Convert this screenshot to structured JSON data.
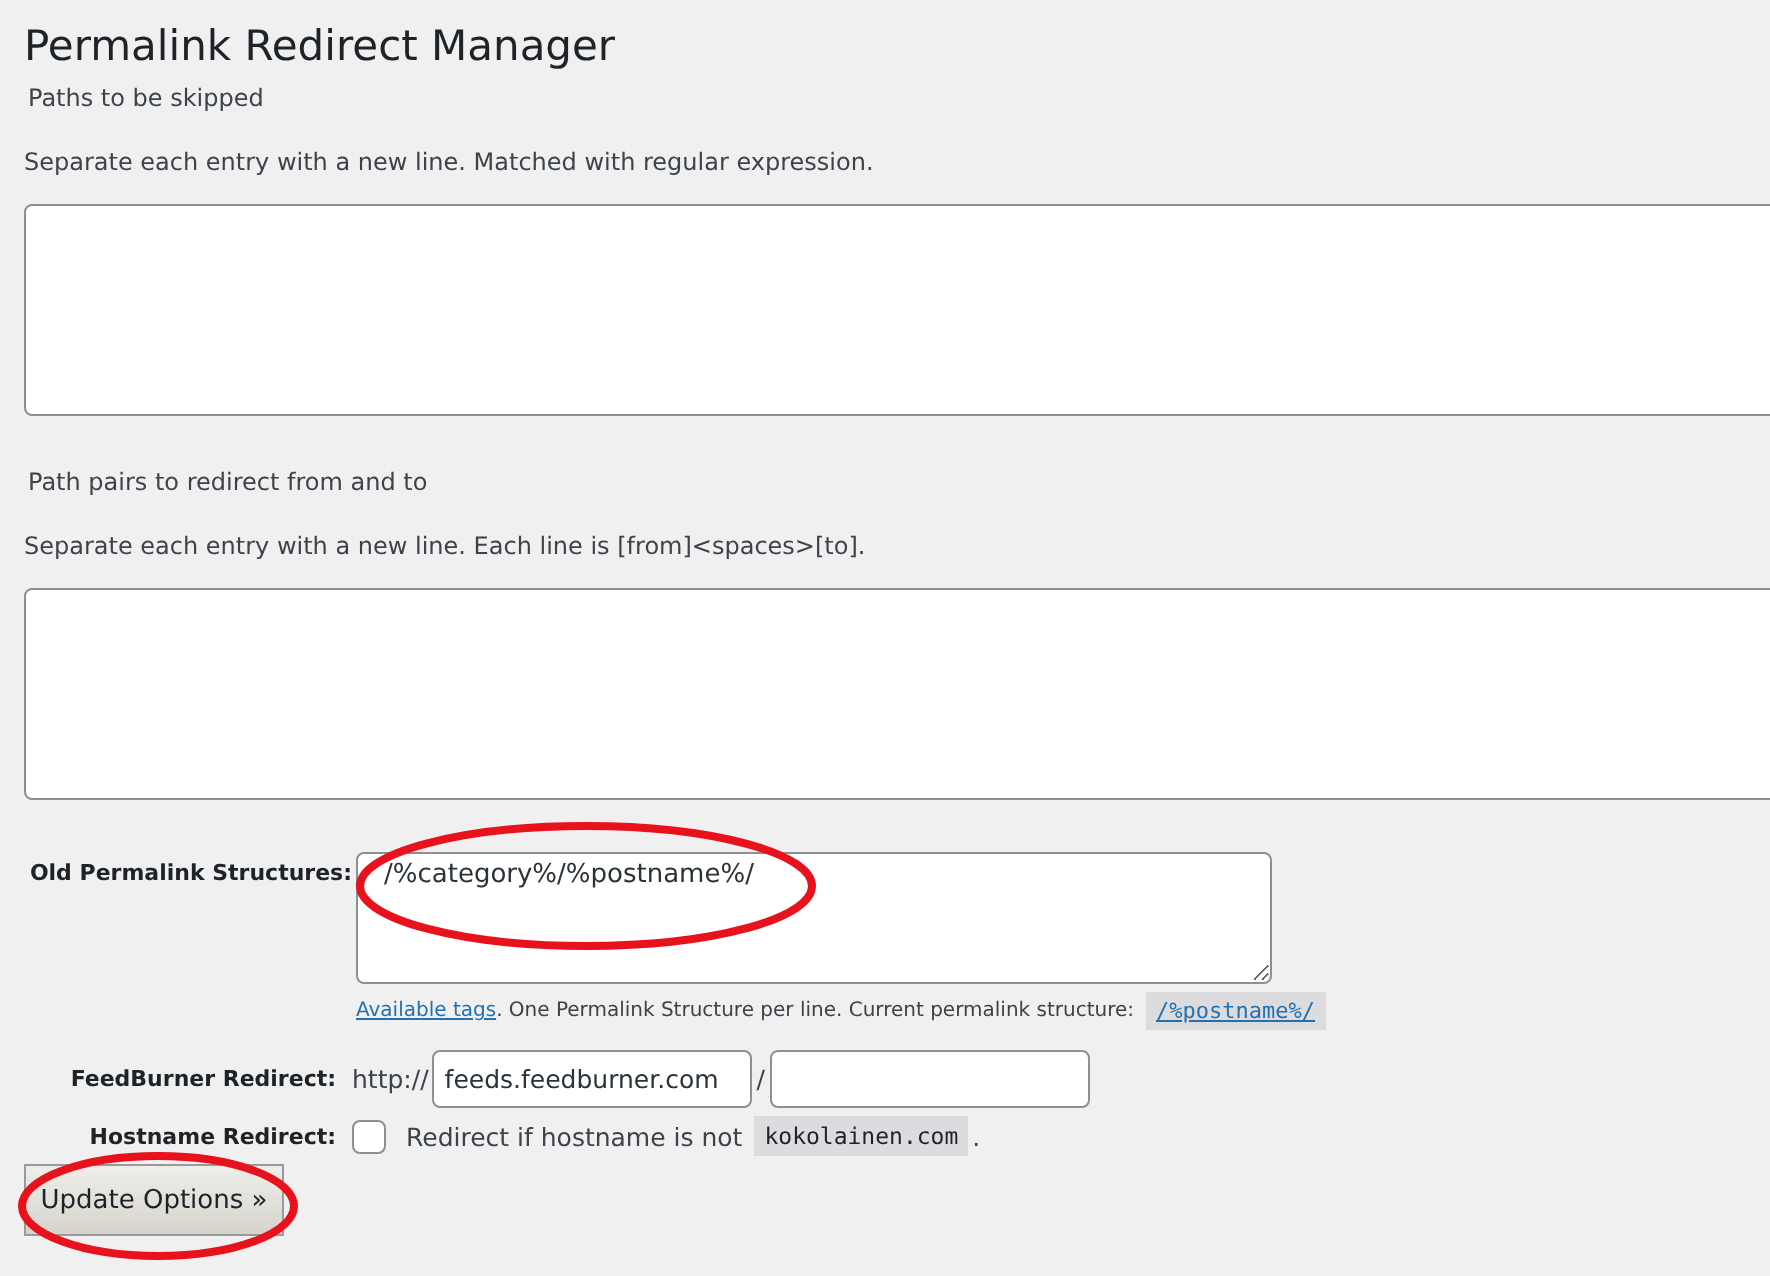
{
  "title": "Permalink Redirect Manager",
  "sections": [
    {
      "heading": "Paths to be skipped",
      "description": "Separate each entry with a new line. Matched with regular expression."
    },
    {
      "heading": "Path pairs to redirect from and to",
      "description": "Separate each entry with a new line. Each line is [from]<spaces>[to]."
    }
  ],
  "old_structures": {
    "label": "Old Permalink Structures:",
    "value": "/%category%/%postname%/",
    "help_link": "Available tags",
    "help_text": ". One Permalink Structure per line. Current permalink structure:",
    "current": "/%postname%/"
  },
  "feedburner": {
    "label": "FeedBurner Redirect:",
    "prefix": "http://",
    "host": "feeds.feedburner.com",
    "separator": "/"
  },
  "hostname": {
    "label": "Hostname Redirect:",
    "checked": false,
    "text": "Redirect if hostname is not",
    "host": "kokolainen.com",
    "suffix": "."
  },
  "submit": "Update Options »"
}
